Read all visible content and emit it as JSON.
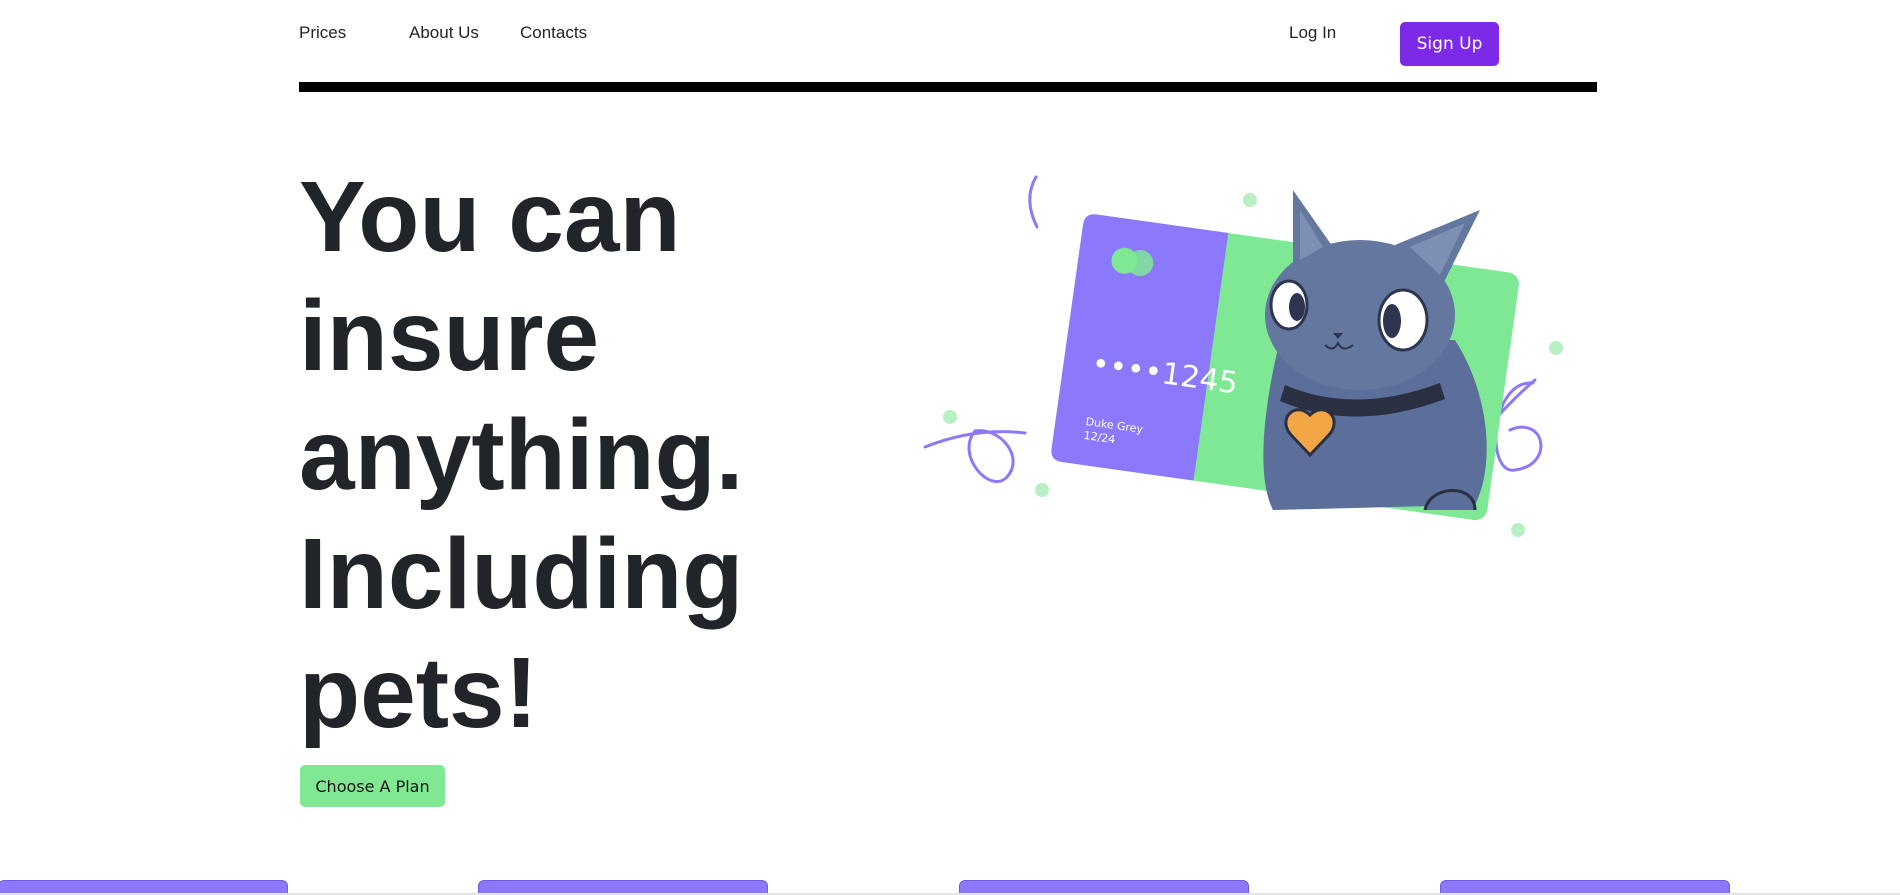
{
  "nav": {
    "links": [
      "Prices",
      "About Us",
      "Contacts"
    ],
    "login_label": "Log In",
    "signup_label": "Sign Up"
  },
  "hero": {
    "title_lines": [
      "You can",
      "insure",
      "anything.",
      "Including",
      "pets!"
    ],
    "cta_label": "Choose A Plan",
    "card": {
      "number": "••••1245",
      "holder": "Duke Grey",
      "expiry": "12/24"
    }
  },
  "colors": {
    "primary": "#7d2ae8",
    "accent_green": "#80e893",
    "card_purple": "#8b78fa",
    "card_green": "#7ee895",
    "text": "#212529"
  },
  "bottom_cards_count": 4
}
